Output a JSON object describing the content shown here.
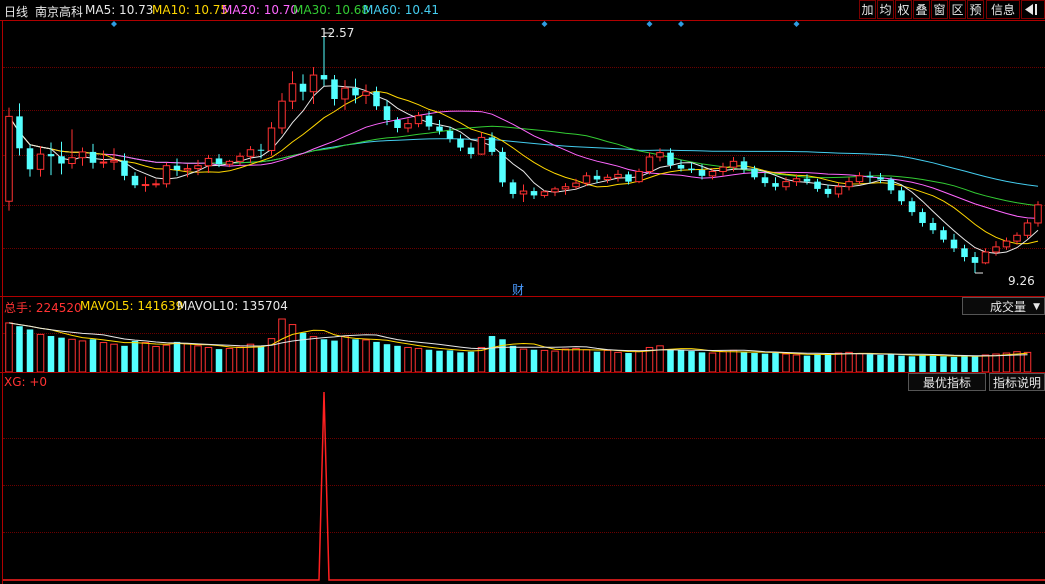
{
  "header": {
    "period": "日线",
    "stock_name": "南京高科",
    "ma": [
      {
        "label": "MA5: 10.73",
        "color": "#e8e8e8"
      },
      {
        "label": "MA10: 10.75",
        "color": "#ffd700"
      },
      {
        "label": "MA20: 10.70",
        "color": "#ff66ff"
      },
      {
        "label": "MA30: 10.68",
        "color": "#33cc33"
      },
      {
        "label": "MA60: 10.41",
        "color": "#44ccee"
      }
    ]
  },
  "toolbar": {
    "buttons": [
      "加",
      "均",
      "权",
      "叠",
      "窗",
      "区",
      "预",
      "信息"
    ],
    "arrow_icon": "exit-arrow-icon"
  },
  "price_chart": {
    "high_label": "12.57",
    "low_label": "9.26",
    "finance_marker": "财"
  },
  "volume_panel": {
    "total_label": "总手: 224520",
    "mavol5_label": "MAVOL5: 141639",
    "mavol10_label": "MAVOL10: 135704",
    "selector_label": "成交量",
    "selector_icon": "dropdown-arrow-icon"
  },
  "indicator_panel": {
    "label": "XG: +0",
    "best_button": "最优指标",
    "help_button": "指标说明"
  },
  "chart_data": {
    "type": "candlestick",
    "series_names": [
      "MA5",
      "MA10",
      "MA20",
      "MA30",
      "MA60"
    ],
    "colors": {
      "up": "#ff3232",
      "down": "#54ffff",
      "ma5": "#e8e8e8",
      "ma10": "#ffd700",
      "ma20": "#ff66ff",
      "ma30": "#33cc33",
      "ma60": "#44ccee",
      "xg": "#ff2020"
    },
    "ohlc": [
      [
        10.25,
        11.54,
        10.12,
        11.42
      ],
      [
        11.42,
        11.6,
        10.88,
        10.98
      ],
      [
        10.98,
        11.03,
        10.59,
        10.69
      ],
      [
        10.69,
        11.01,
        10.59,
        10.9
      ],
      [
        10.9,
        11.06,
        10.61,
        10.87
      ],
      [
        10.87,
        11.07,
        10.62,
        10.77
      ],
      [
        10.77,
        11.24,
        10.7,
        10.85
      ],
      [
        10.85,
        10.99,
        10.74,
        10.93
      ],
      [
        10.93,
        11.04,
        10.7,
        10.78
      ],
      [
        10.78,
        10.95,
        10.71,
        10.79
      ],
      [
        10.79,
        10.98,
        10.68,
        10.81
      ],
      [
        10.81,
        10.91,
        10.54,
        10.6
      ],
      [
        10.6,
        10.65,
        10.43,
        10.47
      ],
      [
        10.47,
        10.59,
        10.38,
        10.48
      ],
      [
        10.48,
        10.55,
        10.44,
        10.49
      ],
      [
        10.49,
        10.78,
        10.44,
        10.74
      ],
      [
        10.74,
        10.84,
        10.6,
        10.68
      ],
      [
        10.68,
        10.76,
        10.58,
        10.7
      ],
      [
        10.7,
        10.82,
        10.61,
        10.74
      ],
      [
        10.74,
        10.89,
        10.64,
        10.84
      ],
      [
        10.84,
        10.9,
        10.72,
        10.76
      ],
      [
        10.76,
        10.82,
        10.72,
        10.8
      ],
      [
        10.8,
        10.92,
        10.75,
        10.87
      ],
      [
        10.87,
        11.01,
        10.78,
        10.96
      ],
      [
        10.96,
        11.04,
        10.84,
        10.95
      ],
      [
        10.95,
        11.34,
        10.88,
        11.26
      ],
      [
        11.26,
        11.74,
        11.18,
        11.63
      ],
      [
        11.63,
        12.04,
        11.52,
        11.87
      ],
      [
        11.87,
        12.0,
        11.64,
        11.76
      ],
      [
        11.76,
        12.1,
        11.59,
        11.99
      ],
      [
        11.99,
        12.57,
        11.84,
        11.93
      ],
      [
        11.93,
        11.99,
        11.57,
        11.66
      ],
      [
        11.66,
        11.92,
        11.51,
        11.81
      ],
      [
        11.81,
        11.94,
        11.6,
        11.71
      ],
      [
        11.71,
        11.86,
        11.59,
        11.76
      ],
      [
        11.76,
        11.83,
        11.51,
        11.56
      ],
      [
        11.56,
        11.64,
        11.3,
        11.37
      ],
      [
        11.37,
        11.41,
        11.2,
        11.26
      ],
      [
        11.26,
        11.39,
        11.2,
        11.32
      ],
      [
        11.32,
        11.48,
        11.27,
        11.43
      ],
      [
        11.43,
        11.49,
        11.23,
        11.28
      ],
      [
        11.28,
        11.37,
        11.17,
        11.22
      ],
      [
        11.22,
        11.28,
        11.06,
        11.11
      ],
      [
        11.11,
        11.17,
        10.94,
        10.99
      ],
      [
        10.99,
        11.06,
        10.84,
        10.9
      ],
      [
        10.9,
        11.2,
        10.89,
        11.13
      ],
      [
        11.13,
        11.2,
        10.88,
        10.93
      ],
      [
        10.93,
        10.99,
        10.45,
        10.51
      ],
      [
        10.51,
        10.55,
        10.29,
        10.35
      ],
      [
        10.35,
        10.48,
        10.24,
        10.39
      ],
      [
        10.39,
        10.44,
        10.28,
        10.33
      ],
      [
        10.33,
        10.4,
        10.3,
        10.38
      ],
      [
        10.38,
        10.45,
        10.32,
        10.42
      ],
      [
        10.42,
        10.5,
        10.34,
        10.45
      ],
      [
        10.45,
        10.56,
        10.42,
        10.5
      ],
      [
        10.5,
        10.65,
        10.46,
        10.6
      ],
      [
        10.6,
        10.68,
        10.5,
        10.55
      ],
      [
        10.55,
        10.62,
        10.5,
        10.58
      ],
      [
        10.58,
        10.68,
        10.52,
        10.62
      ],
      [
        10.62,
        10.66,
        10.48,
        10.52
      ],
      [
        10.52,
        10.7,
        10.5,
        10.66
      ],
      [
        10.66,
        10.92,
        10.62,
        10.86
      ],
      [
        10.86,
        10.98,
        10.8,
        10.92
      ],
      [
        10.92,
        10.98,
        10.7,
        10.75
      ],
      [
        10.75,
        10.82,
        10.66,
        10.7
      ],
      [
        10.7,
        10.78,
        10.64,
        10.68
      ],
      [
        10.68,
        10.76,
        10.55,
        10.6
      ],
      [
        10.6,
        10.7,
        10.55,
        10.66
      ],
      [
        10.66,
        10.78,
        10.6,
        10.72
      ],
      [
        10.72,
        10.86,
        10.66,
        10.8
      ],
      [
        10.8,
        10.86,
        10.64,
        10.7
      ],
      [
        10.7,
        10.74,
        10.55,
        10.58
      ],
      [
        10.58,
        10.64,
        10.45,
        10.5
      ],
      [
        10.5,
        10.58,
        10.4,
        10.45
      ],
      [
        10.45,
        10.58,
        10.4,
        10.52
      ],
      [
        10.52,
        10.62,
        10.46,
        10.56
      ],
      [
        10.56,
        10.62,
        10.48,
        10.52
      ],
      [
        10.52,
        10.56,
        10.38,
        10.42
      ],
      [
        10.42,
        10.48,
        10.3,
        10.35
      ],
      [
        10.35,
        10.5,
        10.3,
        10.45
      ],
      [
        10.45,
        10.58,
        10.4,
        10.52
      ],
      [
        10.52,
        10.65,
        10.48,
        10.6
      ],
      [
        10.6,
        10.66,
        10.5,
        10.58
      ],
      [
        10.58,
        10.64,
        10.5,
        10.55
      ],
      [
        10.55,
        10.58,
        10.35,
        10.4
      ],
      [
        10.4,
        10.45,
        10.2,
        10.25
      ],
      [
        10.25,
        10.3,
        10.05,
        10.1
      ],
      [
        10.1,
        10.15,
        9.9,
        9.95
      ],
      [
        9.95,
        10.02,
        9.8,
        9.85
      ],
      [
        9.85,
        9.9,
        9.68,
        9.72
      ],
      [
        9.72,
        9.8,
        9.55,
        9.6
      ],
      [
        9.6,
        9.65,
        9.42,
        9.48
      ],
      [
        9.48,
        9.55,
        9.26,
        9.4
      ],
      [
        9.4,
        9.6,
        9.38,
        9.55
      ],
      [
        9.55,
        9.7,
        9.5,
        9.62
      ],
      [
        9.62,
        9.75,
        9.58,
        9.7
      ],
      [
        9.7,
        9.82,
        9.65,
        9.78
      ],
      [
        9.78,
        10.0,
        9.74,
        9.95
      ],
      [
        9.95,
        10.25,
        9.9,
        10.2
      ]
    ],
    "volume": [
      150,
      140,
      130,
      115,
      110,
      105,
      100,
      95,
      100,
      90,
      85,
      80,
      95,
      90,
      78,
      82,
      92,
      86,
      80,
      75,
      70,
      72,
      76,
      85,
      80,
      102,
      162,
      145,
      120,
      108,
      100,
      96,
      110,
      100,
      98,
      92,
      85,
      80,
      75,
      72,
      68,
      65,
      66,
      60,
      62,
      75,
      110,
      100,
      80,
      70,
      68,
      66,
      64,
      70,
      72,
      68,
      62,
      66,
      60,
      58,
      64,
      75,
      80,
      70,
      68,
      64,
      60,
      58,
      62,
      66,
      60,
      58,
      56,
      58,
      55,
      52,
      50,
      54,
      56,
      58,
      60,
      56,
      54,
      52,
      55,
      50,
      48,
      52,
      50,
      48,
      46,
      50,
      48,
      52,
      55,
      58,
      62,
      60
    ],
    "xg_signal_index": 30,
    "ylim": [
      9.26,
      12.57
    ]
  }
}
